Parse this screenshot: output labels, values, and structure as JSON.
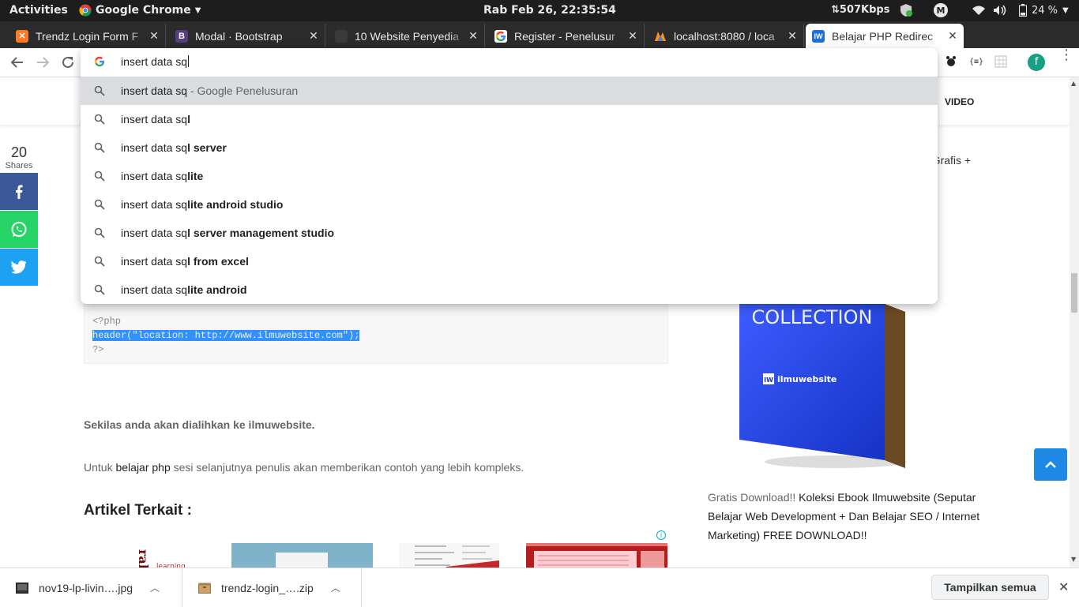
{
  "system_bar": {
    "activities": "Activities",
    "app_name": "Google Chrome",
    "clock": "Rab Feb 26, 22:35:54",
    "net_speed": "⇅507Kbps",
    "battery": "24 %"
  },
  "tabs": [
    {
      "title": "Trendz Login Form F",
      "favicon": "xampp-icon",
      "color": "#fb7a24"
    },
    {
      "title": "Modal · Bootstrap",
      "favicon": "bootstrap-icon",
      "color": "#563d7c"
    },
    {
      "title": "10 Website Penyedia",
      "favicon": "blank-icon",
      "color": "#3a3a3a"
    },
    {
      "title": "Register - Penelusur",
      "favicon": "google-icon",
      "color": "#ffffff"
    },
    {
      "title": "localhost:8080 / loca",
      "favicon": "phpmyadmin-icon",
      "color": "#f7941d"
    },
    {
      "title": "Belajar PHP Redirec",
      "favicon": "ilmuwebsite-icon",
      "color": "#1e6fd9",
      "active": true
    }
  ],
  "omnibox": {
    "query": "insert data sq",
    "suggestions": [
      {
        "prefix": "insert data sq",
        "bold": "",
        "desc": " - Google Penelusuran",
        "selected": true
      },
      {
        "prefix": "insert data sq",
        "bold": "l",
        "desc": ""
      },
      {
        "prefix": "insert data sq",
        "bold": "l server",
        "desc": ""
      },
      {
        "prefix": "insert data sq",
        "bold": "lite",
        "desc": ""
      },
      {
        "prefix": "insert data sq",
        "bold": "lite android studio",
        "desc": ""
      },
      {
        "prefix": "insert data sq",
        "bold": "l server management studio",
        "desc": ""
      },
      {
        "prefix": "insert data sq",
        "bold": "l from excel",
        "desc": ""
      },
      {
        "prefix": "insert data sq",
        "bold": "lite android",
        "desc": ""
      }
    ]
  },
  "profile_initial": "f",
  "page": {
    "nav_video": "VIDEO",
    "share_count": "20",
    "share_label": "Shares",
    "side_top_text": "n Grafis +",
    "code_lines": [
      "<?php",
      "header(\"location: http://www.ilmuwebsite.com\");",
      "?>"
    ],
    "para_bold": "Sekilas anda akan dialihkan ke ilmuwebsite.",
    "para_before": "Untuk ",
    "para_link": "belajar php",
    "para_after": " sesi selanjutnya penulis akan memberikan contoh yang lebih kompleks.",
    "related_heading": "Artikel Terkait :",
    "book_brand": "ilmuwebsite",
    "book_title_fragment": "COLLECTION",
    "side_prefix": "Gratis Download!! ",
    "side_link": "Koleksi Ebook Ilmuwebsite (Seputar Belajar Web Development + Dan Belajar SEO / Internet Marketing) FREE DOWNLOAD!!"
  },
  "downloads": {
    "items": [
      {
        "name": "nov19-lp-livin….jpg",
        "icon": "image-file-icon"
      },
      {
        "name": "trendz-login_….zip",
        "icon": "archive-file-icon"
      }
    ],
    "show_all": "Tampilkan semua"
  }
}
